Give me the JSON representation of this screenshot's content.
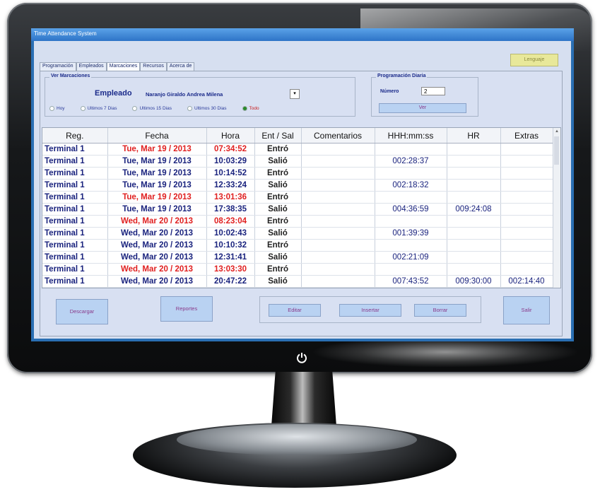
{
  "window": {
    "title": "Time Attendance System"
  },
  "language_button": "Lenguaje",
  "tabs": [
    {
      "label": "Programación",
      "active": false
    },
    {
      "label": "Empleados",
      "active": false
    },
    {
      "label": "Marcaciones",
      "active": true
    },
    {
      "label": "Recursos",
      "active": false
    },
    {
      "label": "Acerca de",
      "active": false
    }
  ],
  "ver_marcaciones": {
    "group_label": "Ver Marcaciones",
    "employee_label": "Empleado",
    "employee_name": "Naranjo Giraldo Andrea Milena",
    "filters": [
      {
        "label": "Hoy",
        "selected": false
      },
      {
        "label": "Ultimos 7 Dias",
        "selected": false
      },
      {
        "label": "Ultimos 15 Dias",
        "selected": false
      },
      {
        "label": "Ultimos 30 Dias",
        "selected": false
      },
      {
        "label": "Todo",
        "selected": true
      }
    ]
  },
  "programacion_diaria": {
    "group_label": "Programación Diaria",
    "number_label": "Número",
    "number_value": "2",
    "ver_button": "Ver"
  },
  "table": {
    "columns": [
      "Reg.",
      "Fecha",
      "Hora",
      "Ent / Sal",
      "Comentarios",
      "HHH:mm:ss",
      "HR",
      "Extras"
    ],
    "rows": [
      {
        "reg": "Terminal 1",
        "fecha": "Tue, Mar 19 / 2013",
        "hora": "07:34:52",
        "ent": "Entró",
        "com": "",
        "hhh": "",
        "hr": "",
        "extras": "",
        "late": true
      },
      {
        "reg": "Terminal 1",
        "fecha": "Tue, Mar 19 / 2013",
        "hora": "10:03:29",
        "ent": "Salió",
        "com": "",
        "hhh": "002:28:37",
        "hr": "",
        "extras": "",
        "late": false
      },
      {
        "reg": "Terminal 1",
        "fecha": "Tue, Mar 19 / 2013",
        "hora": "10:14:52",
        "ent": "Entró",
        "com": "",
        "hhh": "",
        "hr": "",
        "extras": "",
        "late": false
      },
      {
        "reg": "Terminal 1",
        "fecha": "Tue, Mar 19 / 2013",
        "hora": "12:33:24",
        "ent": "Salió",
        "com": "",
        "hhh": "002:18:32",
        "hr": "",
        "extras": "",
        "late": false
      },
      {
        "reg": "Terminal 1",
        "fecha": "Tue, Mar 19 / 2013",
        "hora": "13:01:36",
        "ent": "Entró",
        "com": "",
        "hhh": "",
        "hr": "",
        "extras": "",
        "late": true
      },
      {
        "reg": "Terminal 1",
        "fecha": "Tue, Mar 19 / 2013",
        "hora": "17:38:35",
        "ent": "Salió",
        "com": "",
        "hhh": "004:36:59",
        "hr": "009:24:08",
        "extras": "",
        "late": false
      },
      {
        "reg": "Terminal 1",
        "fecha": "Wed, Mar 20 / 2013",
        "hora": "08:23:04",
        "ent": "Entró",
        "com": "",
        "hhh": "",
        "hr": "",
        "extras": "",
        "late": true
      },
      {
        "reg": "Terminal 1",
        "fecha": "Wed, Mar 20 / 2013",
        "hora": "10:02:43",
        "ent": "Salió",
        "com": "",
        "hhh": "001:39:39",
        "hr": "",
        "extras": "",
        "late": false
      },
      {
        "reg": "Terminal 1",
        "fecha": "Wed, Mar 20 / 2013",
        "hora": "10:10:32",
        "ent": "Entró",
        "com": "",
        "hhh": "",
        "hr": "",
        "extras": "",
        "late": false
      },
      {
        "reg": "Terminal 1",
        "fecha": "Wed, Mar 20 / 2013",
        "hora": "12:31:41",
        "ent": "Salió",
        "com": "",
        "hhh": "002:21:09",
        "hr": "",
        "extras": "",
        "late": false
      },
      {
        "reg": "Terminal 1",
        "fecha": "Wed, Mar 20 / 2013",
        "hora": "13:03:30",
        "ent": "Entró",
        "com": "",
        "hhh": "",
        "hr": "",
        "extras": "",
        "late": true
      },
      {
        "reg": "Terminal 1",
        "fecha": "Wed, Mar 20 / 2013",
        "hora": "20:47:22",
        "ent": "Salió",
        "com": "",
        "hhh": "007:43:52",
        "hr": "009:30:00",
        "extras": "002:14:40",
        "late": false
      }
    ]
  },
  "buttons": {
    "descargar": "Descargar",
    "reportes": "Reportes",
    "editar": "Editar",
    "insertar": "Insertar",
    "borrar": "Borrar",
    "salir": "Salir"
  },
  "colors": {
    "late_text": "#e02020",
    "normal_text": "#1a237e",
    "button_bg": "#b9d2f2"
  }
}
